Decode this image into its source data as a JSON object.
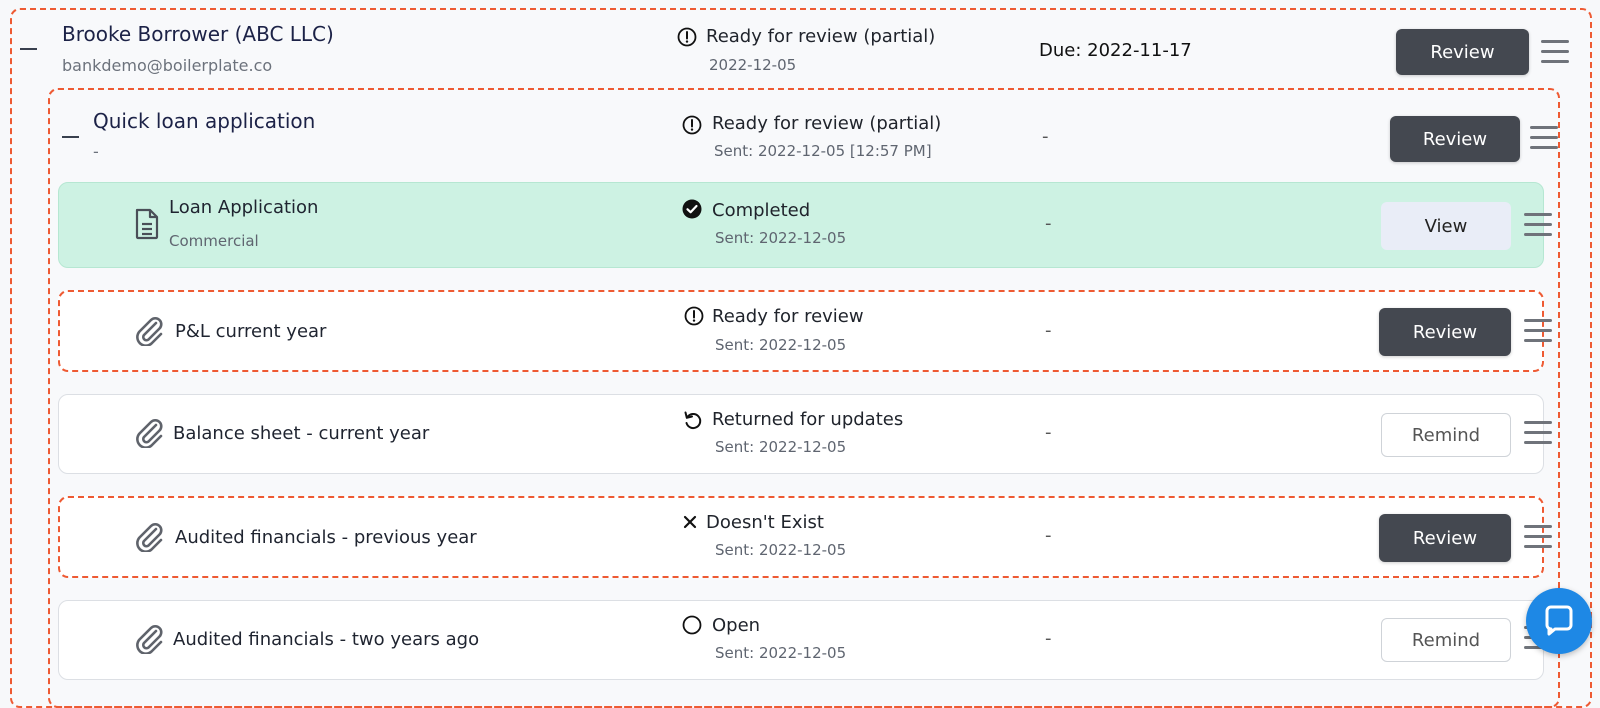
{
  "borrower": {
    "name": "Brooke Borrower (ABC LLC)",
    "email": "bankdemo@boilerplate.co",
    "status": "Ready for review (partial)",
    "status_date": "2022-12-05",
    "due": "Due: 2022-11-17",
    "action": "Review"
  },
  "request": {
    "name": "Quick loan application",
    "sub": "-",
    "status": "Ready for review (partial)",
    "sent": "Sent: 2022-12-05 [12:57 PM]",
    "due": "-",
    "action": "Review"
  },
  "items": [
    {
      "name": "Loan Application",
      "sub": "Commercial",
      "icon": "document-icon",
      "status": "Completed",
      "status_icon": "check-circle-icon",
      "sent": "Sent: 2022-12-05",
      "due": "-",
      "action": "View"
    },
    {
      "name": "P&L current year",
      "icon": "paperclip-icon",
      "status": "Ready for review",
      "status_icon": "alert-circle-icon",
      "sent": "Sent: 2022-12-05",
      "due": "-",
      "action": "Review"
    },
    {
      "name": "Balance sheet - current year",
      "icon": "paperclip-icon",
      "status": "Returned for updates",
      "status_icon": "undo-icon",
      "sent": "Sent: 2022-12-05",
      "due": "-",
      "action": "Remind"
    },
    {
      "name": "Audited financials - previous year",
      "icon": "paperclip-icon",
      "status": "Doesn't Exist",
      "status_icon": "x-icon",
      "sent": "Sent: 2022-12-05",
      "due": "-",
      "action": "Review"
    },
    {
      "name": "Audited financials - two years ago",
      "icon": "paperclip-icon",
      "status": "Open",
      "status_icon": "open-circle-icon",
      "sent": "Sent: 2022-12-05",
      "due": "-",
      "action": "Remind"
    }
  ],
  "colors": {
    "accent_dashed": "#ee5a33",
    "completed_bg": "#cdf2e3",
    "dark_button": "#444850",
    "chat_button": "#1e88e5"
  }
}
